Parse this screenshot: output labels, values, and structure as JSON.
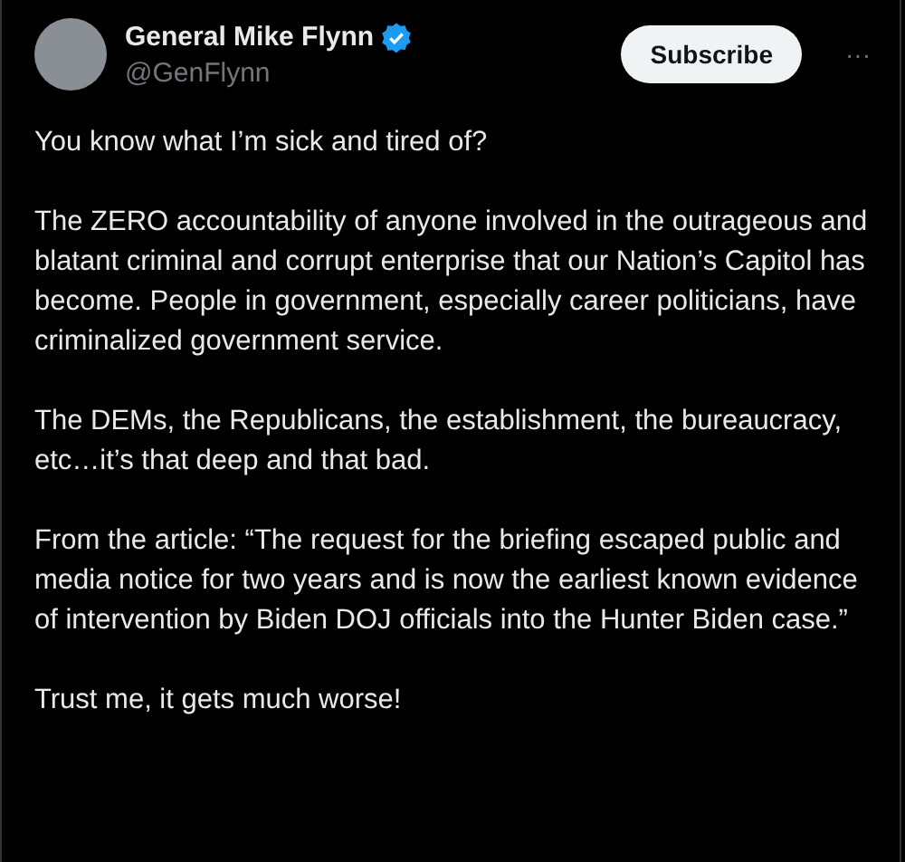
{
  "author": {
    "name": "General Mike Flynn",
    "handle": "@GenFlynn",
    "verified": true
  },
  "subscribe_button": "Subscribe",
  "more_button": "···",
  "paragraphs": [
    "You know what I’m sick and tired of?",
    "The ZERO accountability of anyone involved in the outrageous and blatant criminal and corrupt enterprise that our Nation’s Capitol has become. People in government, especially career politicians, have criminalized government service.",
    "The DEMs, the Republicans, the establishment, the bureaucracy, etc…it’s that deep and that bad.",
    "From the article: “The request for the briefing escaped public and media notice for two years and is now the earliest known evidence of intervention by Biden DOJ officials into the Hunter Biden case.”",
    "Trust me, it gets much worse!"
  ]
}
